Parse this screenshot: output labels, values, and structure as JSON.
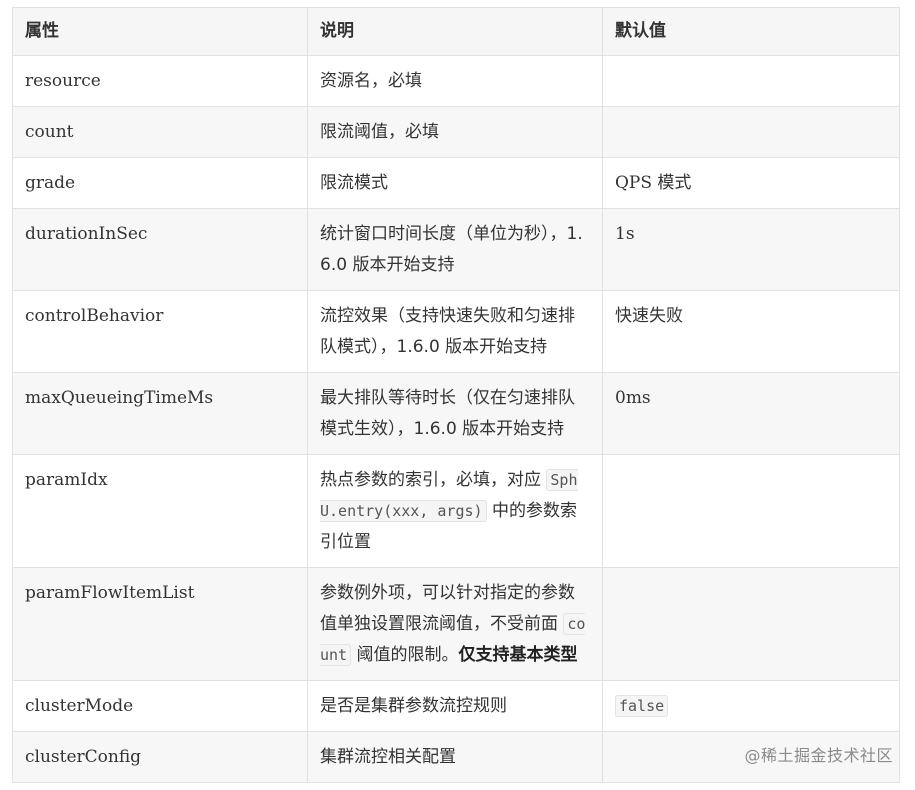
{
  "table": {
    "headers": [
      "属性",
      "说明",
      "默认值"
    ],
    "rows": [
      {
        "name": "resource",
        "desc": "资源名，必填",
        "default": ""
      },
      {
        "name": "count",
        "desc": "限流阈值，必填",
        "default": ""
      },
      {
        "name": "grade",
        "desc": "限流模式",
        "default": "QPS 模式"
      },
      {
        "name": "durationInSec",
        "desc": "统计窗口时间长度（单位为秒），1.6.0 版本开始支持",
        "default": "1s"
      },
      {
        "name": "controlBehavior",
        "desc": "流控效果（支持快速失败和匀速排队模式），1.6.0 版本开始支持",
        "default": "快速失败"
      },
      {
        "name": "maxQueueingTimeMs",
        "desc": "最大排队等待时长（仅在匀速排队模式生效），1.6.0 版本开始支持",
        "default": "0ms"
      },
      {
        "name": "paramIdx",
        "desc_pre": "热点参数的索引，必填，对应 ",
        "desc_code": "SphU.entry(xxx, args)",
        "desc_post": " 中的参数索引位置",
        "default": ""
      },
      {
        "name": "paramFlowItemList",
        "desc_pre": "参数例外项，可以针对指定的参数值单独设置限流阈值，不受前面 ",
        "desc_code": "count",
        "desc_post": " 阈值的限制。",
        "desc_bold": "仅支持基本类型",
        "default": ""
      },
      {
        "name": "clusterMode",
        "desc": "是否是集群参数流控规则",
        "default_code": "false"
      },
      {
        "name": "clusterConfig",
        "desc": "集群流控相关配置",
        "default": ""
      }
    ]
  },
  "watermark": "@稀土掘金技术社区"
}
